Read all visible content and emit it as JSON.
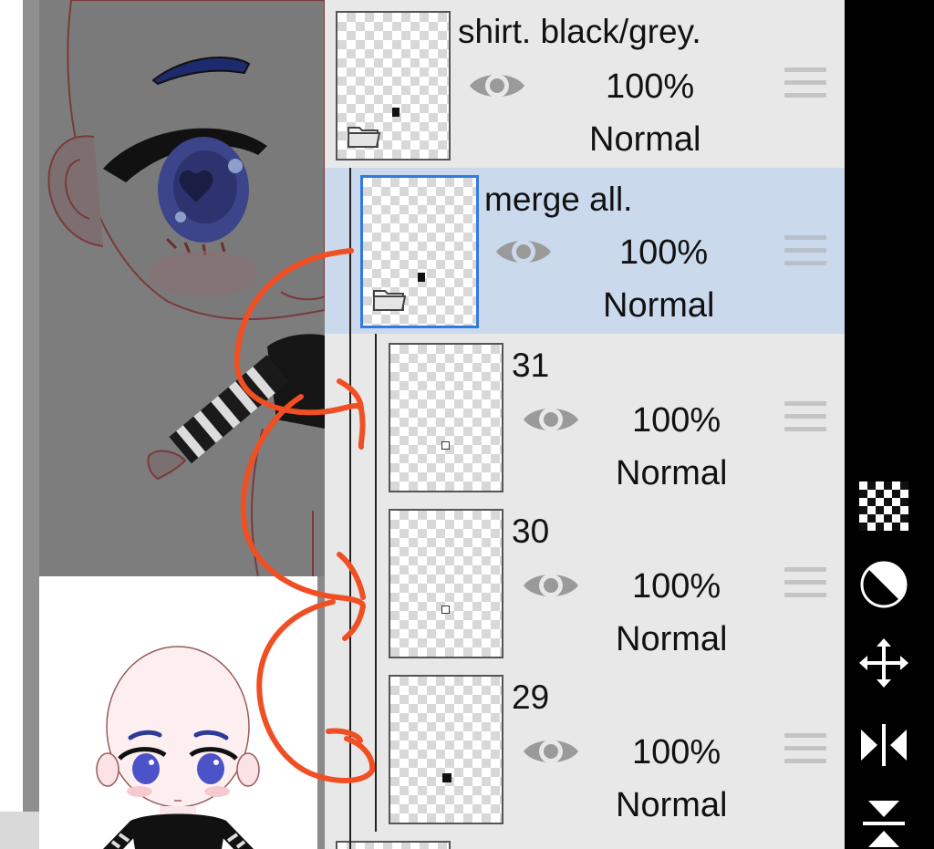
{
  "layers": [
    {
      "name": "shirt. black/grey.",
      "opacity": "100%",
      "blend": "Normal",
      "type": "folder",
      "selected": false
    },
    {
      "name": "merge all.",
      "opacity": "100%",
      "blend": "Normal",
      "type": "folder",
      "selected": true
    },
    {
      "name": "31",
      "opacity": "100%",
      "blend": "Normal",
      "type": "layer",
      "selected": false
    },
    {
      "name": "30",
      "opacity": "100%",
      "blend": "Normal",
      "type": "layer",
      "selected": false
    },
    {
      "name": "29",
      "opacity": "100%",
      "blend": "Normal",
      "type": "layer",
      "selected": false
    }
  ],
  "toolbar": {
    "tools": [
      "checkerboard-icon",
      "opacity-half-circle-icon",
      "move-arrows-icon",
      "flip-horizontal-icon",
      "flip-vertical-icon"
    ]
  },
  "annotation_color": "#f04e23",
  "selection_color": "#2f7be0"
}
